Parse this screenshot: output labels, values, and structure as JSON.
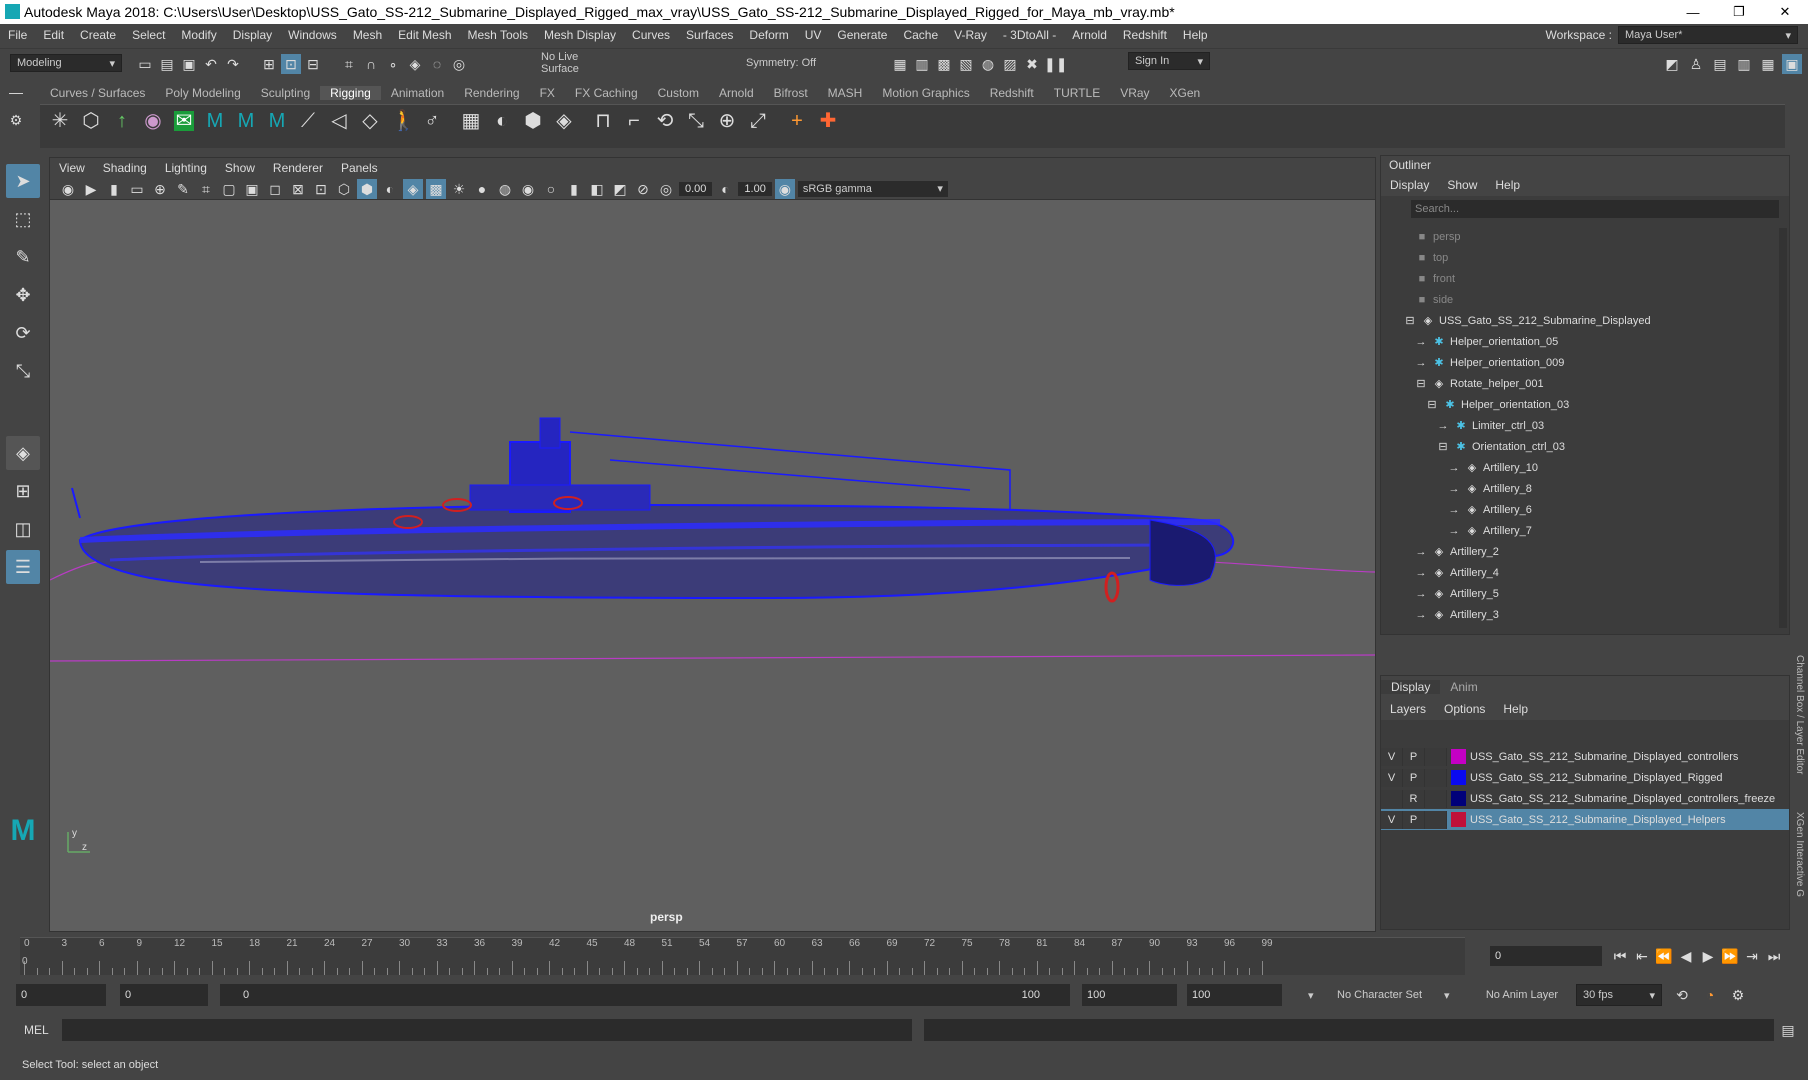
{
  "window": {
    "title": "Autodesk Maya 2018: C:\\Users\\User\\Desktop\\USS_Gato_SS-212_Submarine_Displayed_Rigged_max_vray\\USS_Gato_SS-212_Submarine_Displayed_Rigged_for_Maya_mb_vray.mb*"
  },
  "menus": [
    "File",
    "Edit",
    "Create",
    "Select",
    "Modify",
    "Display",
    "Windows",
    "Mesh",
    "Edit Mesh",
    "Mesh Tools",
    "Mesh Display",
    "Curves",
    "Surfaces",
    "Deform",
    "UV",
    "Generate",
    "Cache",
    "V-Ray",
    "- 3DtoAll -",
    "Arnold",
    "Redshift",
    "Help"
  ],
  "workspace": {
    "label": "Workspace :",
    "value": "Maya User*"
  },
  "status": {
    "mode": "Modeling",
    "live_surface": "No Live Surface",
    "symmetry": "Symmetry: Off",
    "sign_in": "Sign In"
  },
  "shelf_tabs": [
    "Curves / Surfaces",
    "Poly Modeling",
    "Sculpting",
    "Rigging",
    "Animation",
    "Rendering",
    "FX",
    "FX Caching",
    "Custom",
    "Arnold",
    "Bifrost",
    "MASH",
    "Motion Graphics",
    "Redshift",
    "TURTLE",
    "VRay",
    "XGen"
  ],
  "shelf_active": "Rigging",
  "viewport": {
    "menus": [
      "View",
      "Shading",
      "Lighting",
      "Show",
      "Renderer",
      "Panels"
    ],
    "exposure": "0.00",
    "gamma_val": "1.00",
    "color_space": "sRGB gamma",
    "camera": "persp"
  },
  "outliner": {
    "title": "Outliner",
    "menus": [
      "Display",
      "Show",
      "Help"
    ],
    "search": "Search...",
    "nodes": [
      {
        "label": "persp",
        "type": "cam",
        "depth": 0
      },
      {
        "label": "top",
        "type": "cam",
        "depth": 0
      },
      {
        "label": "front",
        "type": "cam",
        "depth": 0
      },
      {
        "label": "side",
        "type": "cam",
        "depth": 0
      },
      {
        "label": "USS_Gato_SS_212_Submarine_Displayed",
        "type": "mesh",
        "depth": 0
      },
      {
        "label": "Helper_orientation_05",
        "type": "helper",
        "depth": 1
      },
      {
        "label": "Helper_orientation_009",
        "type": "helper",
        "depth": 1
      },
      {
        "label": "Rotate_helper_001",
        "type": "mesh",
        "depth": 1
      },
      {
        "label": "Helper_orientation_03",
        "type": "helper",
        "depth": 2
      },
      {
        "label": "Limiter_ctrl_03",
        "type": "helper",
        "depth": 3
      },
      {
        "label": "Orientation_ctrl_03",
        "type": "helper",
        "depth": 3
      },
      {
        "label": "Artillery_10",
        "type": "mesh",
        "depth": 4
      },
      {
        "label": "Artillery_8",
        "type": "mesh",
        "depth": 4
      },
      {
        "label": "Artillery_6",
        "type": "mesh",
        "depth": 4
      },
      {
        "label": "Artillery_7",
        "type": "mesh",
        "depth": 4
      },
      {
        "label": "Artillery_2",
        "type": "mesh",
        "depth": 1
      },
      {
        "label": "Artillery_4",
        "type": "mesh",
        "depth": 1
      },
      {
        "label": "Artillery_5",
        "type": "mesh",
        "depth": 1
      },
      {
        "label": "Artillery_3",
        "type": "mesh",
        "depth": 1
      }
    ]
  },
  "layers": {
    "tabs": [
      "Display",
      "Anim"
    ],
    "menus": [
      "Layers",
      "Options",
      "Help"
    ],
    "rows": [
      {
        "v": "V",
        "p": "P",
        "color": "#c400c4",
        "name": "USS_Gato_SS_212_Submarine_Displayed_controllers"
      },
      {
        "v": "V",
        "p": "P",
        "color": "#0a0af0",
        "name": "USS_Gato_SS_212_Submarine_Displayed_Rigged"
      },
      {
        "v": "",
        "p": "R",
        "color": "#00007a",
        "name": "USS_Gato_SS_212_Submarine_Displayed_controllers_freeze"
      },
      {
        "v": "V",
        "p": "P",
        "color": "#c0103a",
        "name": "USS_Gato_SS_212_Submarine_Displayed_Helpers"
      }
    ],
    "side_tabs": [
      "Channel Box / Layer Editor",
      "XGen Interactive G"
    ]
  },
  "timeline": {
    "ticks": [
      "0",
      "3",
      "6",
      "9",
      "12",
      "15",
      "18",
      "21",
      "24",
      "27",
      "30",
      "33",
      "36",
      "39",
      "42",
      "45",
      "48",
      "51",
      "54",
      "57",
      "60",
      "63",
      "66",
      "69",
      "72",
      "75",
      "78",
      "81",
      "84",
      "87",
      "90",
      "93",
      "96",
      "99"
    ],
    "current": "0",
    "cur_marker": "0"
  },
  "range": {
    "start": "0",
    "start2": "0",
    "slider_start": "0",
    "slider_end": "100",
    "end": "100",
    "end2": "100",
    "char_set": "No Character Set",
    "anim_layer": "No Anim Layer",
    "fps": "30 fps"
  },
  "mel": "MEL",
  "help": "Select Tool: select an object"
}
